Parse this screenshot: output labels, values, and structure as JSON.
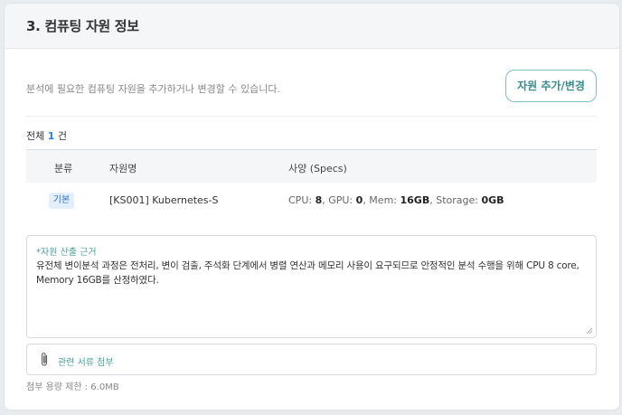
{
  "section": {
    "title": "3. 컴퓨팅 자원 정보"
  },
  "intro": {
    "description": "분석에 필요한 컴퓨팅 자원을 추가하거나 변경할 수 있습니다.",
    "button_label": "자원 추가/변경"
  },
  "summary": {
    "prefix": "전체",
    "count": "1",
    "suffix": "건"
  },
  "table": {
    "headers": [
      "분류",
      "자원명",
      "사양 (Specs)"
    ],
    "rows": [
      {
        "category": "기본",
        "name": "[KS001] Kubernetes-S",
        "specs": {
          "cpu_label": "CPU:",
          "cpu": "8",
          "gpu_label": ", GPU:",
          "gpu": "0",
          "mem_label": ", Mem:",
          "mem": "16GB",
          "storage_label": ", Storage:",
          "storage": "0GB"
        }
      }
    ]
  },
  "rationale": {
    "label": "*자원 산출 근거",
    "text": "유전체 변이분석 과정은 전처리, 변이 검출, 주석화 단계에서 병렬 연산과 메모리 사용이 요구되므로 안정적인 분석 수행을 위해 CPU 8 core, Memory 16GB를 산정하였다."
  },
  "attachment": {
    "label": "관련 서류 첨부",
    "icon": "paperclip-icon",
    "limit_text": "첨부 용량 제한 : 6.0MB"
  }
}
